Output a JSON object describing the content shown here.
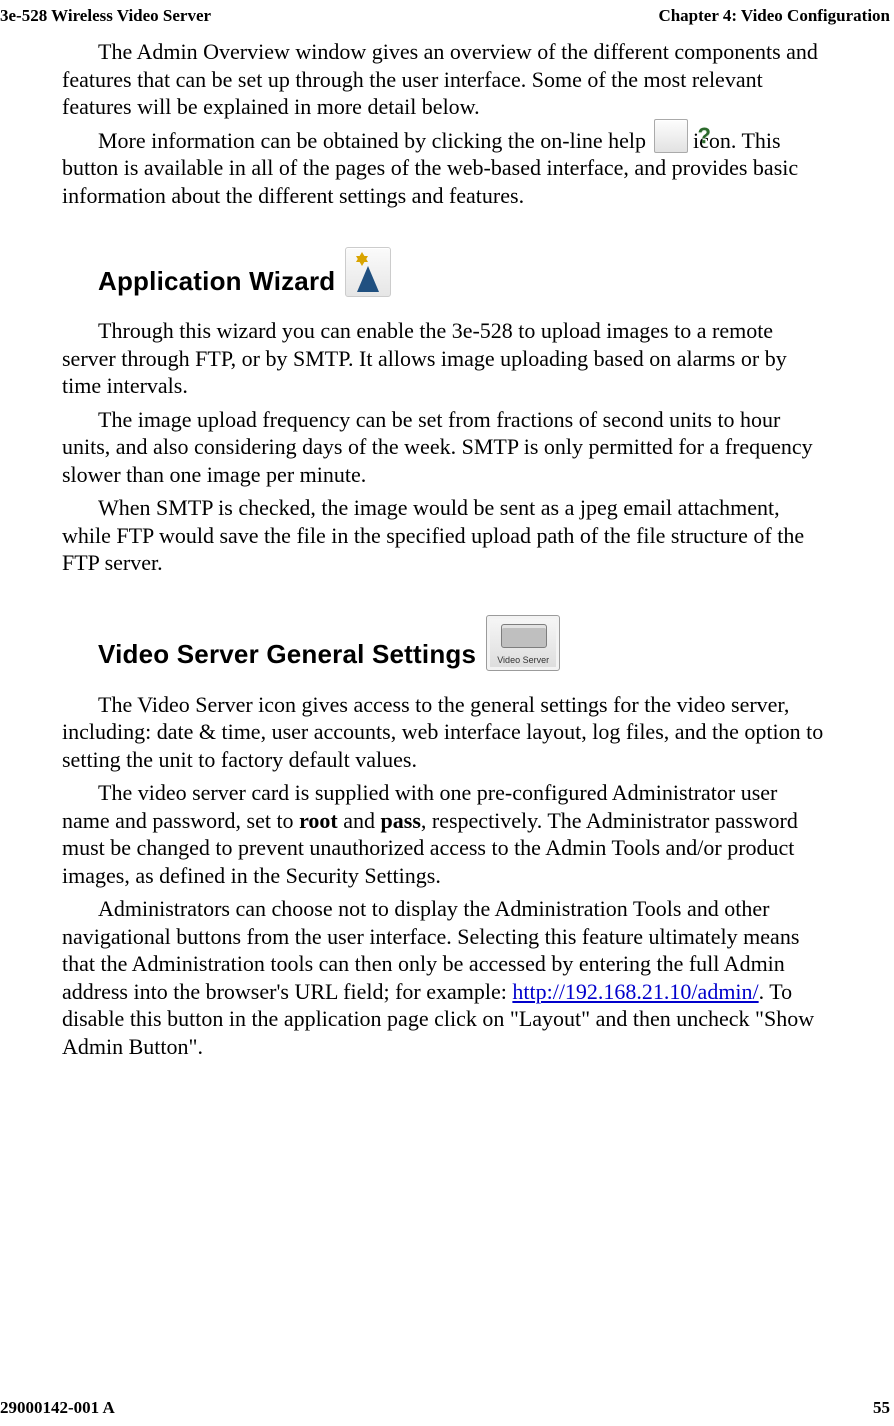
{
  "header": {
    "left": "3e-528 Wireless Video Server",
    "right": "Chapter 4: Video Configuration"
  },
  "intro": {
    "p1": "The Admin Overview window gives an overview of the different components and features that can be set up through the user interface. Some of the most relevant features will be explained in more detail below.",
    "p2a": "More information can be obtained by clicking the on-line help ",
    "p2b": " icon. This button is available in all of the pages of the web-based interface, and provides basic information about the different settings and features."
  },
  "wizard": {
    "heading": "Application Wizard",
    "p1": "Through this wizard you can enable the 3e-528 to upload images to a remote server through FTP, or by SMTP.  It allows image uploading based on alarms or by time intervals.",
    "p2": "The image upload frequency can be set from fractions of second units to hour units, and also considering days of the week. SMTP is only permitted for a frequency slower than one image per minute.",
    "p3": "When SMTP is checked, the image would be sent as a jpeg email attachment, while FTP would save the file in the specified upload path of the file structure of the FTP server."
  },
  "server": {
    "heading": "Video Server General Settings",
    "icon_label": "Video Server",
    "p1": "The Video Server icon gives access to the general settings for the video server, including: date & time, user accounts, web interface layout, log files, and the option to setting the unit to factory default values.",
    "p2a": "The video server card is supplied with one pre-configured Administrator user name and password, set to ",
    "p2_root": "root",
    "p2_mid": " and ",
    "p2_pass": "pass",
    "p2b": ", respectively. The Administrator password must be changed to prevent unauthorized access to the Admin Tools and/or product images, as defined in the Security Settings.",
    "p3a": "Administrators can choose not to display the Administration Tools and other navigational buttons from the user interface. Selecting this feature ultimately means that the Administration tools can then only be accessed by entering the full Admin address into the browser's URL field; for example: ",
    "p3_link": "http://192.168.21.10/admin/",
    "p3b": ". To disable this button in the application page click on \"Layout\" and then uncheck \"Show Admin Button\"."
  },
  "footer": {
    "left": "29000142-001 A",
    "right": "55"
  }
}
